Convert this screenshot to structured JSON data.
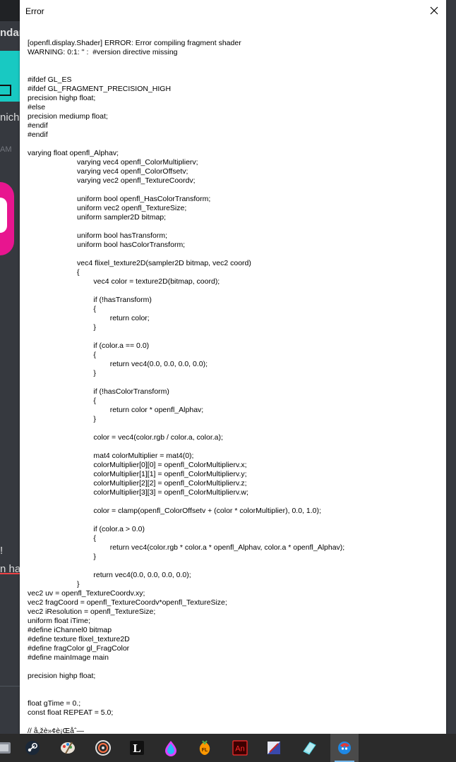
{
  "dialog": {
    "title": "Error",
    "message": "[openfl.display.Shader] ERROR: Error compiling fragment shader\nWARNING: 0:1: '' :  #version directive missing\n\n\n#ifdef GL_ES\n#ifdef GL_FRAGMENT_PRECISION_HIGH\nprecision highp float;\n#else\nprecision mediump float;\n#endif\n#endif\n\nvarying float openfl_Alphav;\n\t\t\tvarying vec4 openfl_ColorMultiplierv;\n\t\t\tvarying vec4 openfl_ColorOffsetv;\n\t\t\tvarying vec2 openfl_TextureCoordv;\n\n\t\t\tuniform bool openfl_HasColorTransform;\n\t\t\tuniform vec2 openfl_TextureSize;\n\t\t\tuniform sampler2D bitmap;\n\n\t\t\tuniform bool hasTransform;\n\t\t\tuniform bool hasColorTransform;\n\n\t\t\tvec4 flixel_texture2D(sampler2D bitmap, vec2 coord)\n\t\t\t{\n\t\t\t\tvec4 color = texture2D(bitmap, coord);\n\n\t\t\t\tif (!hasTransform)\n\t\t\t\t{\n\t\t\t\t\treturn color;\n\t\t\t\t}\n\n\t\t\t\tif (color.a == 0.0)\n\t\t\t\t{\n\t\t\t\t\treturn vec4(0.0, 0.0, 0.0, 0.0);\n\t\t\t\t}\n\n\t\t\t\tif (!hasColorTransform)\n\t\t\t\t{\n\t\t\t\t\treturn color * openfl_Alphav;\n\t\t\t\t}\n\n\t\t\t\tcolor = vec4(color.rgb / color.a, color.a);\n\n\t\t\t\tmat4 colorMultiplier = mat4(0);\n\t\t\t\tcolorMultiplier[0][0] = openfl_ColorMultiplierv.x;\n\t\t\t\tcolorMultiplier[1][1] = openfl_ColorMultiplierv.y;\n\t\t\t\tcolorMultiplier[2][2] = openfl_ColorMultiplierv.z;\n\t\t\t\tcolorMultiplier[3][3] = openfl_ColorMultiplierv.w;\n\n\t\t\t\tcolor = clamp(openfl_ColorOffsetv + (color * colorMultiplier), 0.0, 1.0);\n\n\t\t\t\tif (color.a > 0.0)\n\t\t\t\t{\n\t\t\t\t\treturn vec4(color.rgb * color.a * openfl_Alphav, color.a * openfl_Alphav);\n\t\t\t\t}\n\n\t\t\t\treturn vec4(0.0, 0.0, 0.0, 0.0);\n\t\t\t}\nvec2 uv = openfl_TextureCoordv.xy;\nvec2 fragCoord = openfl_TextureCoordv*openfl_TextureSize;\nvec2 iResolution = openfl_TextureSize;\nuniform float iTime;\n#define iChannel0 bitmap\n#define texture flixel_texture2D\n#define fragColor gl_FragColor\n#define mainImage main\n\nprecision highp float;\n\n\nfloat gTime = 0.;\nconst float REPEAT = 5.0;\n\n// å,žè»¢è¡Œåˆ—"
  },
  "background": {
    "fragments": [
      "ndar",
      "nich",
      "AM",
      "!",
      "n ha"
    ]
  },
  "taskbar": {
    "items": [
      {
        "name": "unknown-app-icon",
        "label": ""
      },
      {
        "name": "steam-icon",
        "label": ""
      },
      {
        "name": "paint-app-icon",
        "label": ""
      },
      {
        "name": "media-player-icon",
        "label": ""
      },
      {
        "name": "l-app-icon",
        "label": "L"
      },
      {
        "name": "krita-icon",
        "label": ""
      },
      {
        "name": "fl-studio-icon",
        "label": ""
      },
      {
        "name": "animate-icon",
        "label": "An"
      },
      {
        "name": "image-editor-icon",
        "label": ""
      },
      {
        "name": "eraser-app-icon",
        "label": ""
      },
      {
        "name": "game-app-icon",
        "label": ""
      }
    ]
  },
  "colors": {
    "accent": "#76b9ed",
    "pink": "#e8158f",
    "cyan": "#18c9c2",
    "animate_red": "#ff2b2b"
  }
}
